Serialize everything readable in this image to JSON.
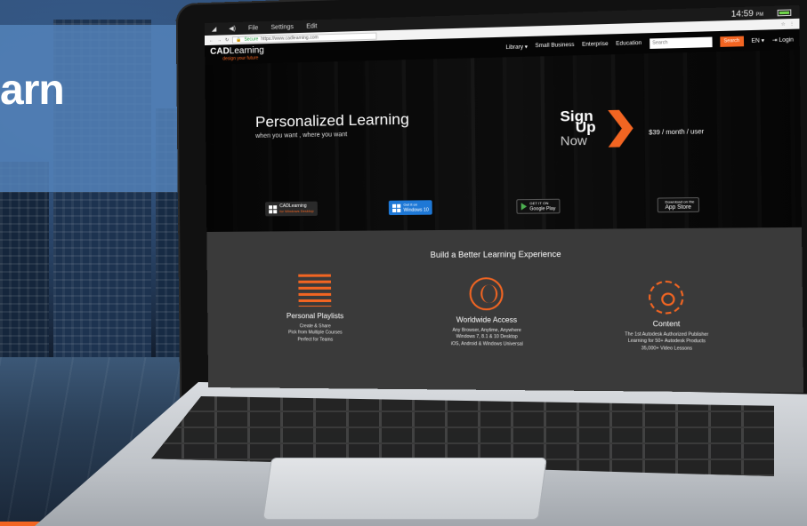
{
  "banner": {
    "text": "arn"
  },
  "os_bar": {
    "menu": [
      "File",
      "Settings",
      "Edit"
    ],
    "time": "14:59",
    "time_suffix": "PM"
  },
  "browser": {
    "secure_label": "Secure",
    "url": "https://www.cadlearning.com"
  },
  "site_nav": {
    "logo_bold": "CAD",
    "logo_rest": "Learning",
    "logo_tagline": "design your future",
    "links": [
      "Library",
      "Small Business",
      "Enterprise",
      "Education"
    ],
    "search_placeholder": "Search",
    "search_button": "Search",
    "language": "EN",
    "login": "Login"
  },
  "hero": {
    "title": "Personalized Learning",
    "subtitle": "when you want , where you want",
    "signup_sign": "Sign",
    "signup_up": "Up",
    "signup_now": "Now",
    "price": "$39 / month / user",
    "badges": {
      "cad_label": "CADLearning",
      "cad_sub": "for Windows Desktop",
      "windows_small": "Get it on",
      "windows_label": "Windows 10",
      "google_small": "GET IT ON",
      "google_label": "Google Play",
      "apple_small": "Download on the",
      "apple_label": "App Store"
    }
  },
  "features": {
    "title": "Build a Better Learning Experience",
    "items": [
      {
        "name": "Personal Playlists",
        "lines": [
          "Create & Share",
          "Pick from Multiple Courses",
          "Perfect for Teams"
        ]
      },
      {
        "name": "Worldwide Access",
        "lines": [
          "Any Browser, Anytime, Anywhere",
          "Windows 7, 8.1 & 10 Desktop",
          "iOS, Android & Windows Universal"
        ]
      },
      {
        "name": "Content",
        "lines": [
          "The 1st Autodesk Authorized Publisher",
          "Learning for 50+ Autodesk Products",
          "35,000+ Video Lessons"
        ]
      }
    ]
  },
  "colors": {
    "accent": "#f26522",
    "banner": "#5482ba",
    "features_bg": "#3a3a3a"
  }
}
